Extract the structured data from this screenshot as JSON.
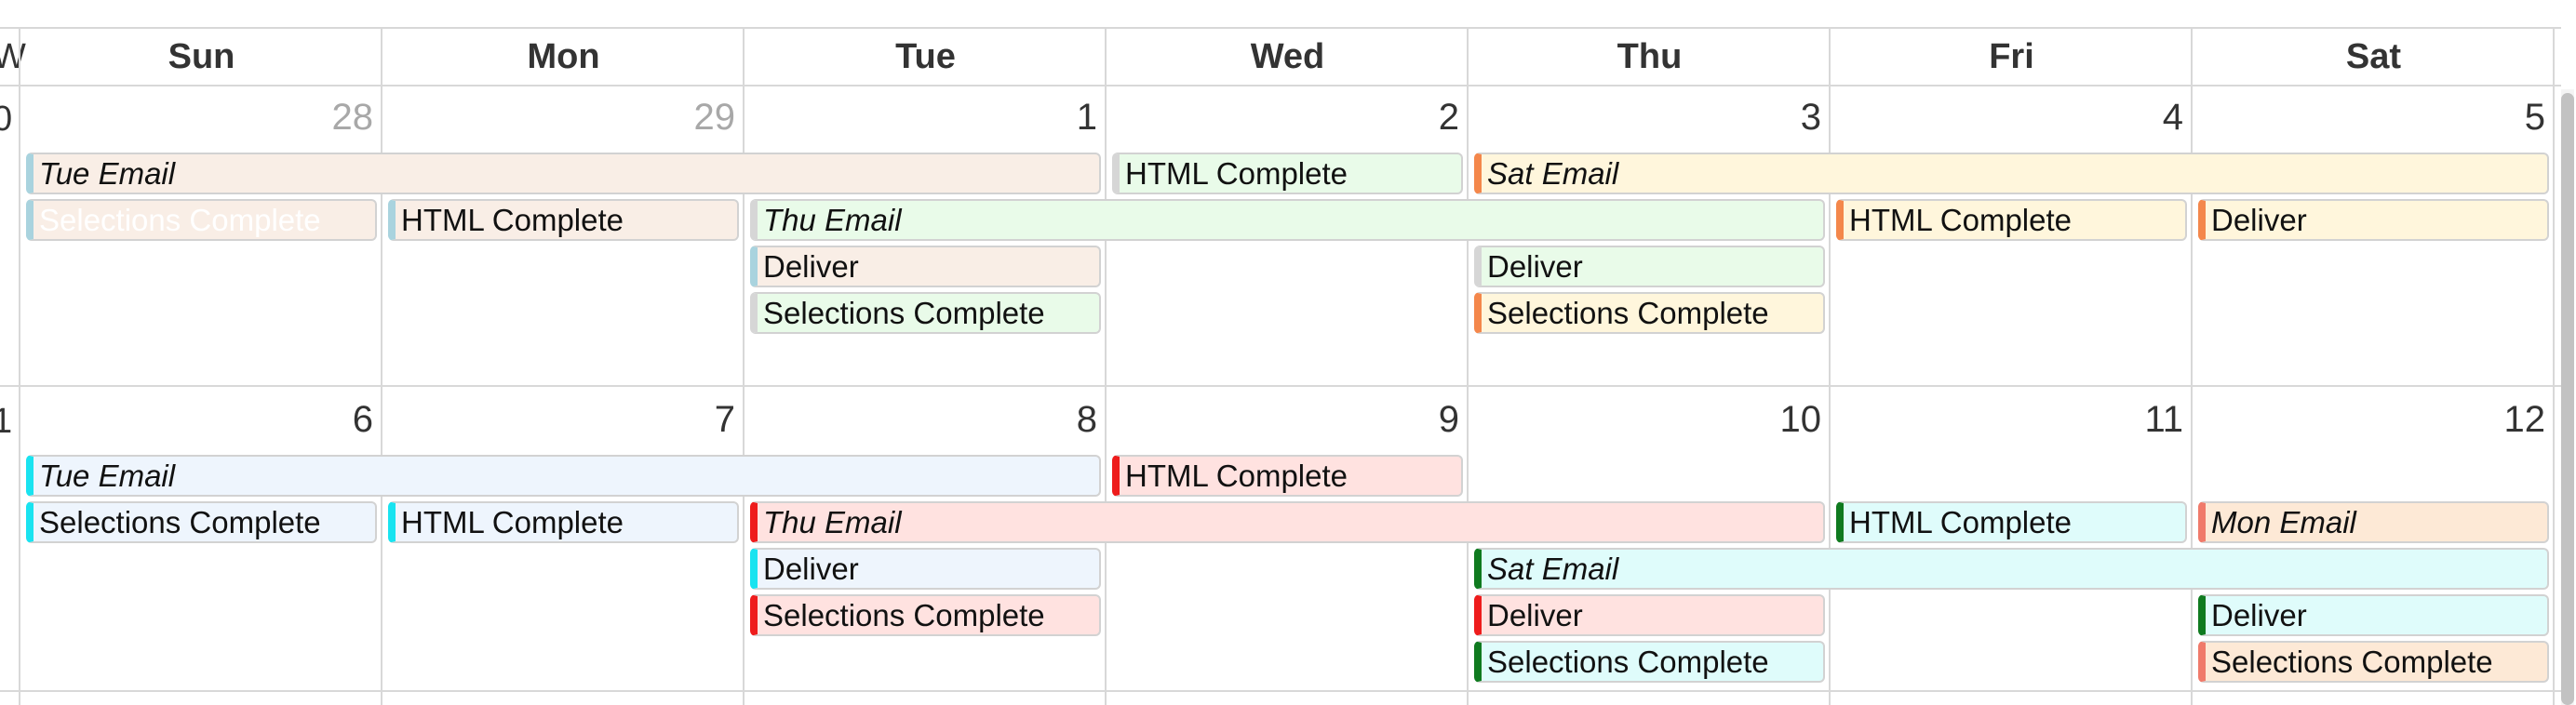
{
  "header": {
    "week_label_fragment": "W",
    "days": [
      "Sun",
      "Mon",
      "Tue",
      "Wed",
      "Thu",
      "Fri",
      "Sat"
    ]
  },
  "weeks": [
    {
      "week_number_fragment": "0",
      "days": [
        {
          "num": "28",
          "other_month": true
        },
        {
          "num": "29",
          "other_month": true
        },
        {
          "num": "1",
          "other_month": false
        },
        {
          "num": "2",
          "other_month": false
        },
        {
          "num": "3",
          "other_month": false
        },
        {
          "num": "4",
          "other_month": false
        },
        {
          "num": "5",
          "other_month": false
        }
      ],
      "events": [
        {
          "title": "Tue Email",
          "start": 0,
          "span": 3,
          "row": 0,
          "italic": true,
          "bg": "#f9eee6",
          "accent": "#a9d3de"
        },
        {
          "title": "HTML Complete",
          "start": 3,
          "span": 1,
          "row": 0,
          "italic": false,
          "bg": "#e9fbe9",
          "accent": "#d6d6d6"
        },
        {
          "title": "Sat Email",
          "start": 4,
          "span": 3,
          "row": 0,
          "italic": true,
          "bg": "#fff6dc",
          "accent": "#f4874b"
        },
        {
          "title": "Selections Complete",
          "start": 0,
          "span": 1,
          "row": 1,
          "italic": false,
          "bg": "#f9eee6",
          "accent": "#a9d3de",
          "ghost": true
        },
        {
          "title": "HTML Complete",
          "start": 1,
          "span": 1,
          "row": 1,
          "italic": false,
          "bg": "#f9eee6",
          "accent": "#a9d3de"
        },
        {
          "title": "Thu Email",
          "start": 2,
          "span": 3,
          "row": 1,
          "italic": true,
          "bg": "#e9fbe9",
          "accent": "#d6d6d6"
        },
        {
          "title": "HTML Complete",
          "start": 5,
          "span": 1,
          "row": 1,
          "italic": false,
          "bg": "#fff6dc",
          "accent": "#f4874b"
        },
        {
          "title": "Deliver",
          "start": 6,
          "span": 1,
          "row": 1,
          "italic": false,
          "bg": "#fff6dc",
          "accent": "#f4874b"
        },
        {
          "title": "Deliver",
          "start": 2,
          "span": 1,
          "row": 2,
          "italic": false,
          "bg": "#f9eee6",
          "accent": "#a9d3de"
        },
        {
          "title": "Deliver",
          "start": 4,
          "span": 1,
          "row": 2,
          "italic": false,
          "bg": "#e9fbe9",
          "accent": "#d6d6d6"
        },
        {
          "title": "Selections Complete",
          "start": 2,
          "span": 1,
          "row": 3,
          "italic": false,
          "bg": "#e9fbe9",
          "accent": "#d6d6d6"
        },
        {
          "title": "Selections Complete",
          "start": 4,
          "span": 1,
          "row": 3,
          "italic": false,
          "bg": "#fff6dc",
          "accent": "#f4874b"
        }
      ]
    },
    {
      "week_number_fragment": "1",
      "days": [
        {
          "num": "6",
          "other_month": false
        },
        {
          "num": "7",
          "other_month": false
        },
        {
          "num": "8",
          "other_month": false
        },
        {
          "num": "9",
          "other_month": false
        },
        {
          "num": "10",
          "other_month": false
        },
        {
          "num": "11",
          "other_month": false
        },
        {
          "num": "12",
          "other_month": false
        }
      ],
      "events": [
        {
          "title": "Tue Email",
          "start": 0,
          "span": 3,
          "row": 0,
          "italic": true,
          "bg": "#eef5fd",
          "accent": "#19e3f0"
        },
        {
          "title": "HTML Complete",
          "start": 3,
          "span": 1,
          "row": 0,
          "italic": false,
          "bg": "#ffe2e0",
          "accent": "#ee1c1c"
        },
        {
          "title": "Selections Complete",
          "start": 0,
          "span": 1,
          "row": 1,
          "italic": false,
          "bg": "#eef5fd",
          "accent": "#19e3f0"
        },
        {
          "title": "HTML Complete",
          "start": 1,
          "span": 1,
          "row": 1,
          "italic": false,
          "bg": "#eef5fd",
          "accent": "#19e3f0"
        },
        {
          "title": "Thu Email",
          "start": 2,
          "span": 3,
          "row": 1,
          "italic": true,
          "bg": "#ffe2e0",
          "accent": "#ee1c1c"
        },
        {
          "title": "HTML Complete",
          "start": 5,
          "span": 1,
          "row": 1,
          "italic": false,
          "bg": "#dffcfb",
          "accent": "#0f7a1f"
        },
        {
          "title": "Mon Email",
          "start": 6,
          "span": 1,
          "row": 1,
          "italic": true,
          "bg": "#fde9d6",
          "accent": "#f07a6a"
        },
        {
          "title": "Deliver",
          "start": 2,
          "span": 1,
          "row": 2,
          "italic": false,
          "bg": "#eef5fd",
          "accent": "#19e3f0"
        },
        {
          "title": "Sat Email",
          "start": 4,
          "span": 3,
          "row": 2,
          "italic": true,
          "bg": "#dffcfb",
          "accent": "#0f7a1f"
        },
        {
          "title": "Selections Complete",
          "start": 2,
          "span": 1,
          "row": 3,
          "italic": false,
          "bg": "#ffe2e0",
          "accent": "#ee1c1c"
        },
        {
          "title": "Deliver",
          "start": 4,
          "span": 1,
          "row": 3,
          "italic": false,
          "bg": "#ffe2e0",
          "accent": "#ee1c1c"
        },
        {
          "title": "Deliver",
          "start": 6,
          "span": 1,
          "row": 3,
          "italic": false,
          "bg": "#dffcfb",
          "accent": "#0f7a1f"
        },
        {
          "title": "Selections Complete",
          "start": 4,
          "span": 1,
          "row": 4,
          "italic": false,
          "bg": "#dffcfb",
          "accent": "#0f7a1f"
        },
        {
          "title": "Selections Complete",
          "start": 6,
          "span": 1,
          "row": 4,
          "italic": false,
          "bg": "#fde9d6",
          "accent": "#f07a6a"
        }
      ]
    }
  ]
}
